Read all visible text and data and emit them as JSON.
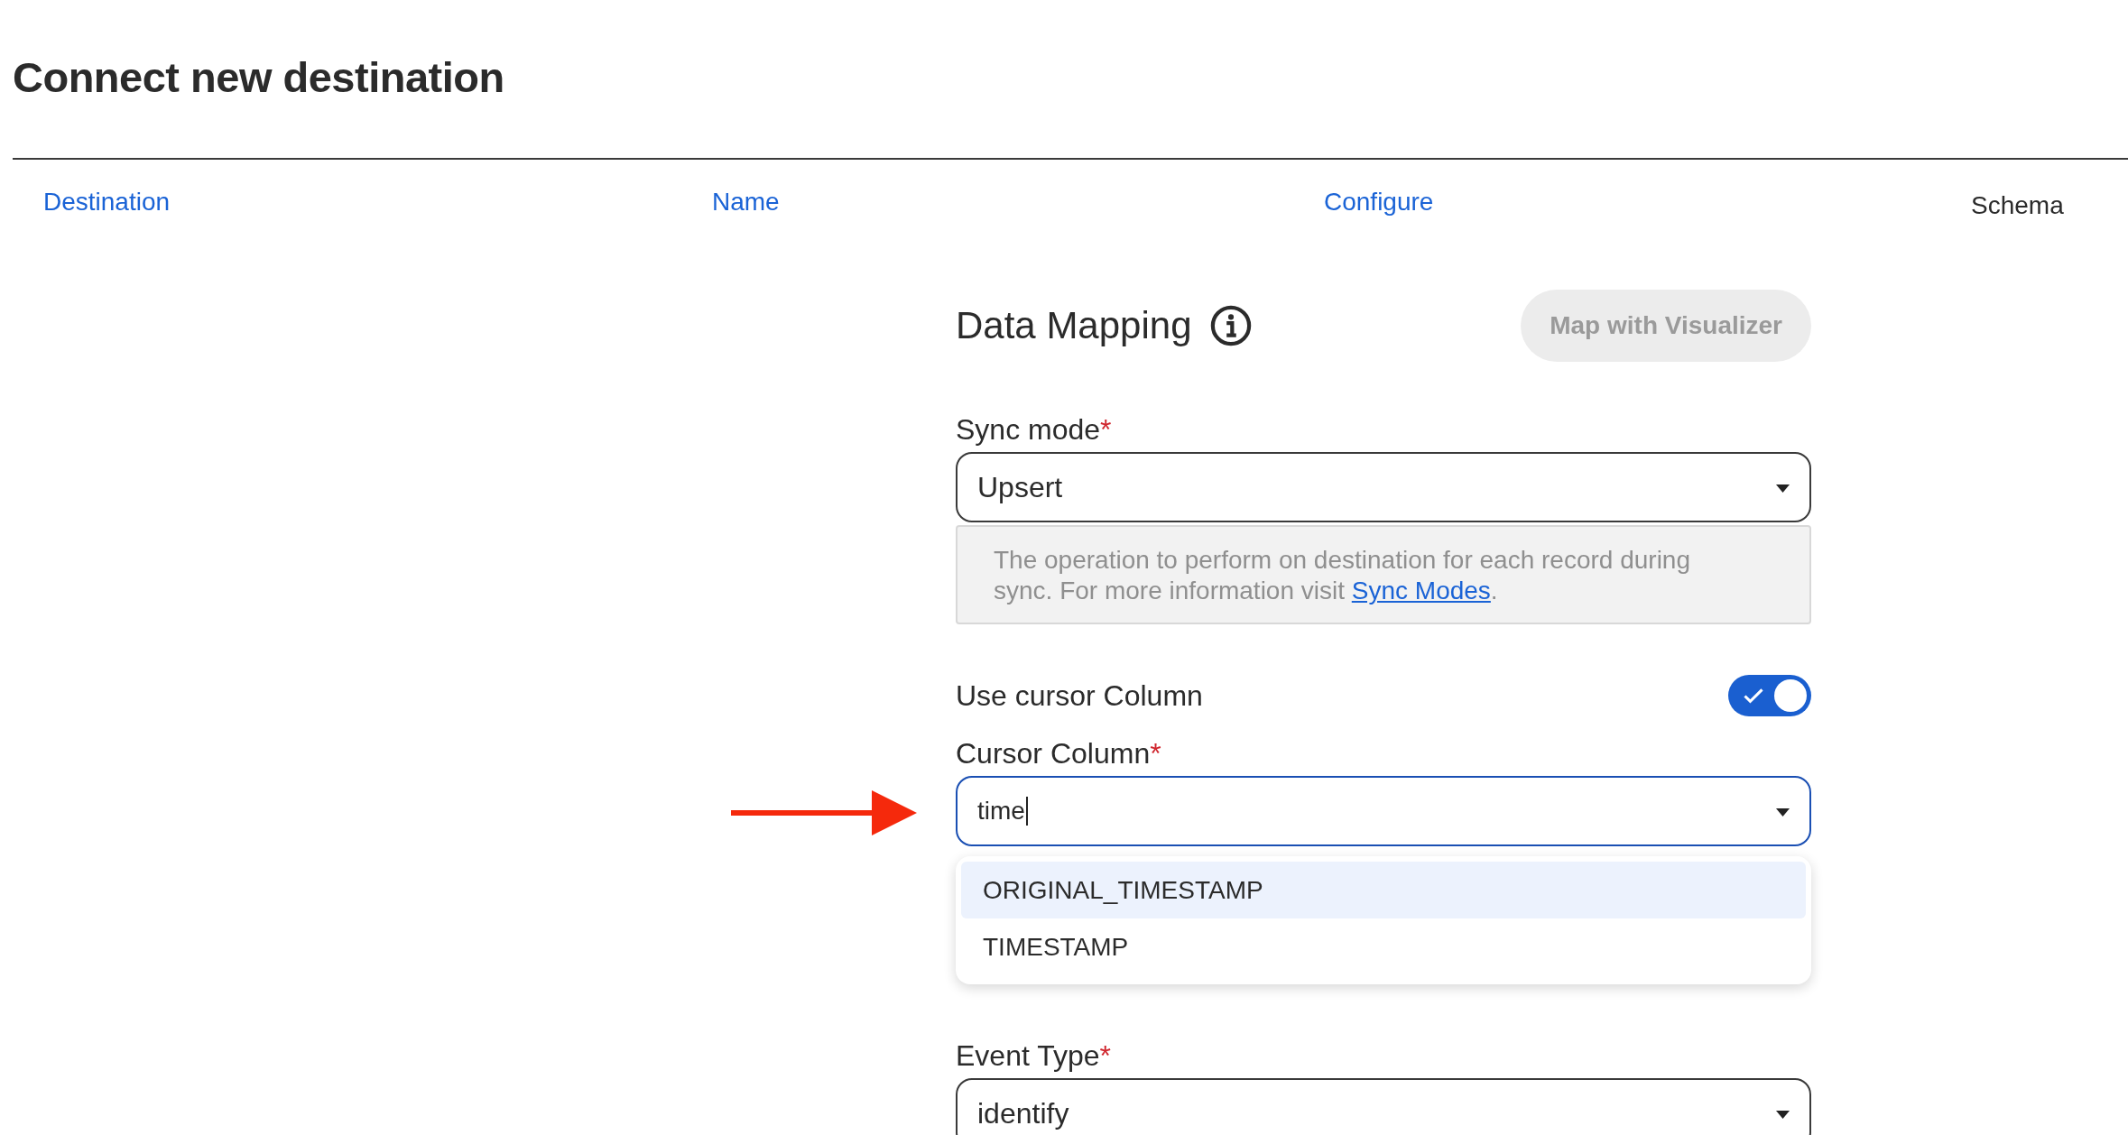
{
  "page": {
    "title": "Connect new destination"
  },
  "steps": [
    {
      "label": "Destination",
      "selected": false
    },
    {
      "label": "Name",
      "selected": false
    },
    {
      "label": "Configure",
      "selected": false
    },
    {
      "label": "Schema",
      "selected": true
    }
  ],
  "section": {
    "title": "Data Mapping",
    "visualizer_button": {
      "label": "Map with Visualizer",
      "disabled": true
    }
  },
  "sync_mode": {
    "label": "Sync mode",
    "required_mark": "*",
    "value": "Upsert",
    "help": "The operation to perform on destination for each record during sync. For more information visit ",
    "help_link": "Sync Modes",
    "help_end": "."
  },
  "use_cursor": {
    "label": "Use cursor Column",
    "on": true
  },
  "cursor_column": {
    "label": "Cursor Column",
    "required_mark": "*",
    "value": "time",
    "options": [
      {
        "label": "ORIGINAL_TIMESTAMP",
        "selected": true
      },
      {
        "label": "TIMESTAMP",
        "selected": false
      }
    ]
  },
  "event_type": {
    "label": "Event Type",
    "required_mark": "*",
    "value": "identify"
  }
}
